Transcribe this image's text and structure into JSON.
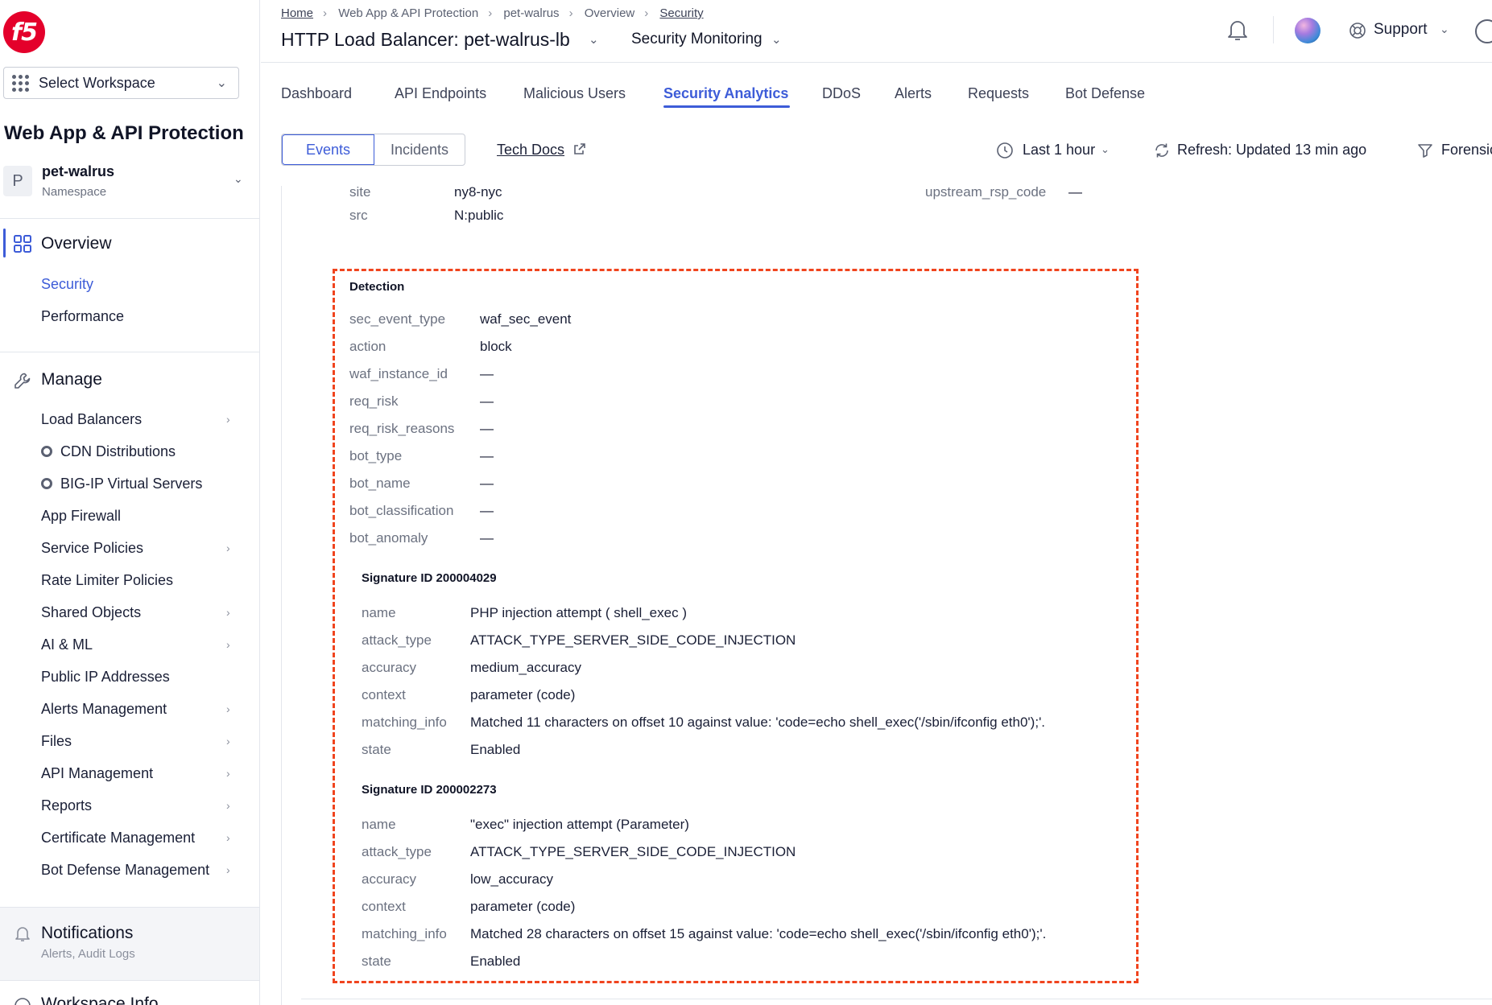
{
  "sidebar": {
    "logo_text": "f5",
    "workspace_select": "Select Workspace",
    "app_title": "Web App & API Protection",
    "namespace": {
      "initial": "P",
      "name": "pet-walrus",
      "label": "Namespace"
    },
    "overview": {
      "label": "Overview",
      "items": [
        "Security",
        "Performance"
      ]
    },
    "manage": {
      "label": "Manage",
      "items": [
        {
          "label": "Load Balancers",
          "chevron": true
        },
        {
          "label": "CDN Distributions",
          "icon": "ring-icon"
        },
        {
          "label": "BIG-IP Virtual Servers",
          "icon": "ring-icon"
        },
        {
          "label": "App Firewall"
        },
        {
          "label": "Service Policies",
          "chevron": true
        },
        {
          "label": "Rate Limiter Policies"
        },
        {
          "label": "Shared Objects",
          "chevron": true
        },
        {
          "label": "AI & ML",
          "chevron": true
        },
        {
          "label": "Public IP Addresses"
        },
        {
          "label": "Alerts Management",
          "chevron": true
        },
        {
          "label": "Files",
          "chevron": true
        },
        {
          "label": "API Management",
          "chevron": true
        },
        {
          "label": "Reports",
          "chevron": true
        },
        {
          "label": "Certificate Management",
          "chevron": true
        },
        {
          "label": "Bot Defense Management",
          "chevron": true
        }
      ]
    },
    "notifications": {
      "label": "Notifications",
      "sub": "Alerts, Audit Logs"
    },
    "workspace_info": "Workspace Info"
  },
  "header": {
    "breadcrumbs": [
      "Home",
      "Web App & API Protection",
      "pet-walrus",
      "Overview",
      "Security"
    ],
    "lb_title": "HTTP Load Balancer: pet-walrus-lb",
    "monitoring_title": "Security Monitoring",
    "support": "Support"
  },
  "tabs": [
    "Dashboard",
    "API Endpoints",
    "Malicious Users",
    "Security Analytics",
    "DDoS",
    "Alerts",
    "Requests",
    "Bot Defense"
  ],
  "active_tab": "Security Analytics",
  "toolbar": {
    "segments": [
      "Events",
      "Incidents"
    ],
    "tech_docs": "Tech Docs",
    "time_range": "Last 1 hour",
    "refresh": "Refresh: Updated 13 min ago",
    "forensics": "Forensic"
  },
  "content": {
    "top_rows": [
      {
        "key": "site",
        "value": "ny8-nyc"
      },
      {
        "key": "src",
        "value": "N:public"
      }
    ],
    "right_row": {
      "key": "upstream_rsp_code",
      "value": "—"
    },
    "detection": {
      "title": "Detection",
      "rows": [
        {
          "key": "sec_event_type",
          "value": "waf_sec_event"
        },
        {
          "key": "action",
          "value": "block"
        },
        {
          "key": "waf_instance_id",
          "value": "—"
        },
        {
          "key": "req_risk",
          "value": "—"
        },
        {
          "key": "req_risk_reasons",
          "value": "—"
        },
        {
          "key": "bot_type",
          "value": "—"
        },
        {
          "key": "bot_name",
          "value": "—"
        },
        {
          "key": "bot_classification",
          "value": "—"
        },
        {
          "key": "bot_anomaly",
          "value": "—"
        }
      ],
      "signatures": [
        {
          "title": "Signature ID 200004029",
          "rows": [
            {
              "key": "name",
              "value": "PHP injection attempt ( shell_exec )"
            },
            {
              "key": "attack_type",
              "value": "ATTACK_TYPE_SERVER_SIDE_CODE_INJECTION"
            },
            {
              "key": "accuracy",
              "value": "medium_accuracy"
            },
            {
              "key": "context",
              "value": "parameter (code)"
            },
            {
              "key": "matching_info",
              "value": "Matched 11 characters on offset 10 against value: 'code=echo shell_exec('/sbin/ifconfig eth0');'."
            },
            {
              "key": "state",
              "value": "Enabled"
            }
          ]
        },
        {
          "title": "Signature ID 200002273",
          "rows": [
            {
              "key": "name",
              "value": "\"exec\" injection attempt (Parameter)"
            },
            {
              "key": "attack_type",
              "value": "ATTACK_TYPE_SERVER_SIDE_CODE_INJECTION"
            },
            {
              "key": "accuracy",
              "value": "low_accuracy"
            },
            {
              "key": "context",
              "value": "parameter (code)"
            },
            {
              "key": "matching_info",
              "value": "Matched 28 characters on offset 15 against value: 'code=echo shell_exec('/sbin/ifconfig eth0');'."
            },
            {
              "key": "state",
              "value": "Enabled"
            }
          ]
        }
      ]
    }
  },
  "colors": {
    "accent": "#3d5cd8",
    "highlight_border": "#f0441e",
    "brand": "#e4002b"
  }
}
